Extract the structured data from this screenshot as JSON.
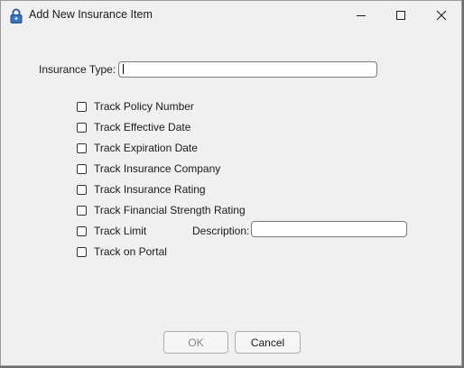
{
  "window": {
    "title": "Add New Insurance Item",
    "icon": "padlock-icon",
    "controls": [
      "minimize-icon",
      "maximize-icon",
      "close-icon"
    ]
  },
  "form": {
    "insurance_type_label": "Insurance Type:",
    "insurance_type_value": "",
    "checkboxes": [
      {
        "label": "Track Policy Number",
        "checked": false
      },
      {
        "label": "Track Effective Date",
        "checked": false
      },
      {
        "label": "Track Expiration Date",
        "checked": false
      },
      {
        "label": "Track Insurance Company",
        "checked": false
      },
      {
        "label": "Track Insurance Rating",
        "checked": false
      },
      {
        "label": "Track Financial Strength Rating",
        "checked": false
      },
      {
        "label": "Track Limit",
        "checked": false
      },
      {
        "label": "Track on  Portal",
        "checked": false
      }
    ],
    "description_label": "Description:",
    "description_value": ""
  },
  "buttons": {
    "ok_label": "OK",
    "cancel_label": "Cancel"
  }
}
